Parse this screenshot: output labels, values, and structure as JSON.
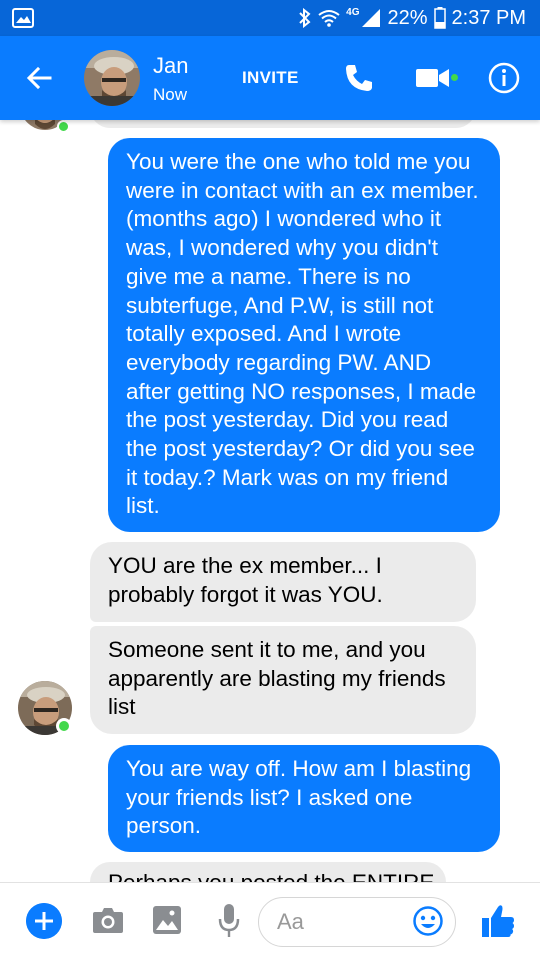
{
  "status_bar": {
    "network": "4G",
    "battery": "22%",
    "time": "2:37 PM"
  },
  "header": {
    "contact_name": "Jan",
    "contact_status": "Now",
    "invite_label": "INVITE",
    "icons": [
      "back-arrow-icon",
      "phone-icon",
      "video-camera-icon",
      "info-icon"
    ]
  },
  "messages": [
    {
      "sender": "me",
      "text": "You were the one who told me you were in contact with an ex member. (months ago) I wondered who it was, I wondered why you didn't give me a name. There is no subterfuge, And P.W, is still not totally exposed. And I wrote everybody regarding PW. AND after getting NO responses, I made the post yesterday.  Did you read the post yesterday? Or did you see it today.? Mark was on my friend list."
    },
    {
      "sender": "them",
      "text": "YOU are the ex member... I probably forgot it was YOU."
    },
    {
      "sender": "them",
      "text": "Someone sent it to me, and you apparently are blasting my friends list"
    },
    {
      "sender": "me",
      "text": "You are way off. How am I blasting your friends list? I asked one person."
    },
    {
      "sender": "them",
      "text": "Perhaps you posted the ENTIRE"
    }
  ],
  "composer": {
    "placeholder": "Aa",
    "icons": [
      "plus-icon",
      "camera-icon",
      "gallery-icon",
      "microphone-icon",
      "emoji-icon",
      "thumbs-up-icon"
    ]
  },
  "colors": {
    "status_bar": "#0766d8",
    "header": "#0a7cff",
    "my_bubble": "#0a7cff",
    "their_bubble": "#ebebeb",
    "online": "#42d84b"
  }
}
